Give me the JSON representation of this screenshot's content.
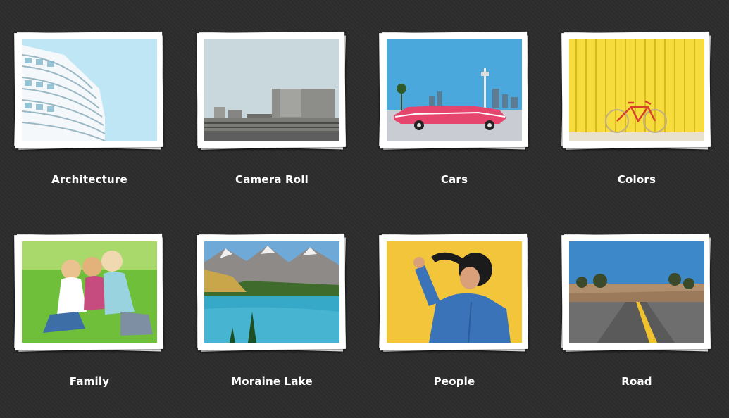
{
  "albums": [
    {
      "title": "Architecture",
      "photo": "building-balconies"
    },
    {
      "title": "Camera Roll",
      "photo": "brutalist-building"
    },
    {
      "title": "Cars",
      "photo": "pink-cadillac-las-vegas"
    },
    {
      "title": "Colors",
      "photo": "bicycle-yellow-wall"
    },
    {
      "title": "Family",
      "photo": "children-on-grass"
    },
    {
      "title": "Moraine Lake",
      "photo": "mountain-lake"
    },
    {
      "title": "People",
      "photo": "person-yellow-background"
    },
    {
      "title": "Road",
      "photo": "desert-road"
    }
  ],
  "colors": {
    "background": "#2d2d2d",
    "frame": "#ffffff",
    "title": "#ffffff"
  }
}
